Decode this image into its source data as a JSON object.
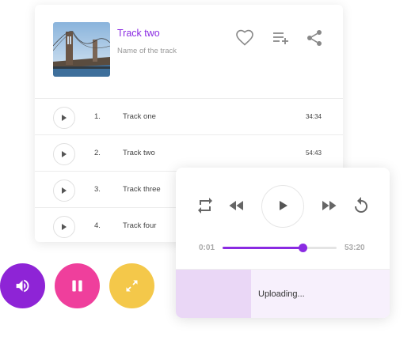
{
  "now_playing": {
    "title": "Track two",
    "subtitle": "Name of the track",
    "cover_icon": "bridge-photo"
  },
  "header_icons": [
    "heart-icon",
    "playlist-add-icon",
    "share-icon"
  ],
  "tracks": [
    {
      "number": "1.",
      "name": "Track one",
      "duration": "34:34"
    },
    {
      "number": "2.",
      "name": "Track two",
      "duration": "54:43"
    },
    {
      "number": "3.",
      "name": "Track three",
      "duration": ""
    },
    {
      "number": "4.",
      "name": "Track four",
      "duration": ""
    }
  ],
  "fabs": [
    {
      "icon": "volume-icon",
      "color": "#8e24d6"
    },
    {
      "icon": "pause-icon",
      "color": "#ef3f9c"
    },
    {
      "icon": "expand-icon",
      "color": "#f4c84a"
    }
  ],
  "player": {
    "elapsed": "0:01",
    "total": "53:20",
    "progress": 0.7,
    "accent": "#8a2be2",
    "controls": [
      "repeat-icon",
      "rewind-icon",
      "play-icon",
      "fast-forward-icon",
      "replay-icon"
    ]
  },
  "upload": {
    "label": "Uploading...",
    "progress": 0.35
  }
}
